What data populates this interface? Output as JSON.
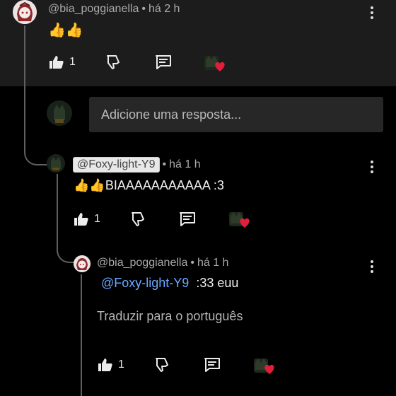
{
  "comments": [
    {
      "author": "@bia_poggianella",
      "time": "há 2 h",
      "text": "👍👍",
      "likes": "1"
    },
    {
      "author": "@Foxy-light-Y9",
      "time": "há 1 h",
      "text": "👍👍BIAAAAAAAAAAA :3",
      "likes": "1"
    },
    {
      "author": "@bia_poggianella",
      "time": "há 1 h",
      "mention": "@Foxy-light-Y9",
      "text": ":33 euu",
      "translate_label": "Traduzir para o português",
      "likes": "1"
    }
  ],
  "reply_box": {
    "placeholder": "Adicione uma resposta..."
  },
  "separator": "•",
  "icons": {
    "like": "thumb-up-icon",
    "dislike": "thumb-down-icon",
    "reply": "reply-comment-icon",
    "creator_heart": "creator-heart-icon",
    "menu": "more-vert-icon"
  },
  "colors": {
    "background": "#000000",
    "top_band": "#1c1c1c",
    "mention": "#6aa8ff",
    "heart": "#e0203a"
  }
}
